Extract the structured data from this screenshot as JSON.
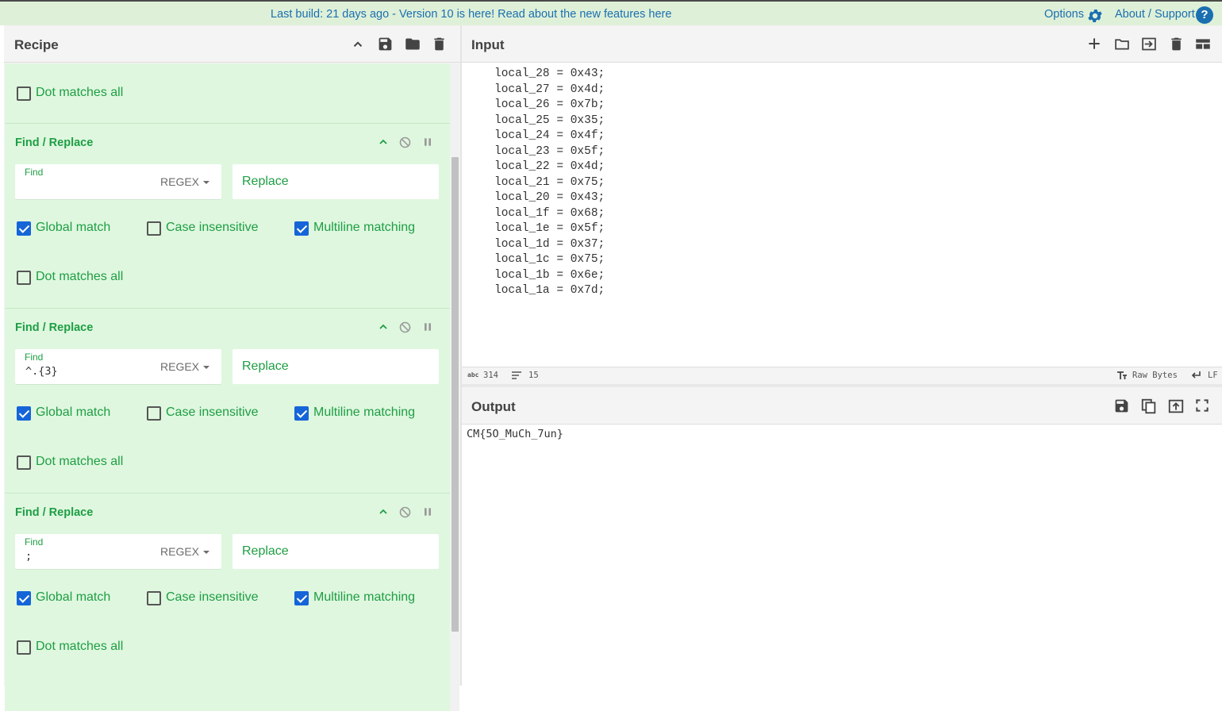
{
  "banner": {
    "message": "Last build: 21 days ago - Version 10 is here! Read about the new features here",
    "options_label": "Options",
    "about_label": "About / Support",
    "help_glyph": "?"
  },
  "recipe": {
    "title": "Recipe",
    "first_op_tail": {
      "dot_label": "Dot matches all"
    },
    "operations": [
      {
        "title": "Find / Replace",
        "find_label": "Find",
        "find_value": "",
        "mode": "REGEX",
        "replace_placeholder": "Replace",
        "global_label": "Global match",
        "case_label": "Case insensitive",
        "multiline_label": "Multiline matching",
        "dot_label": "Dot matches all",
        "global_checked": true,
        "case_checked": false,
        "multiline_checked": true,
        "dot_checked": false
      },
      {
        "title": "Find / Replace",
        "find_label": "Find",
        "find_value": "^.{3}",
        "mode": "REGEX",
        "replace_placeholder": "Replace",
        "global_label": "Global match",
        "case_label": "Case insensitive",
        "multiline_label": "Multiline matching",
        "dot_label": "Dot matches all",
        "global_checked": true,
        "case_checked": false,
        "multiline_checked": true,
        "dot_checked": false
      },
      {
        "title": "Find / Replace",
        "find_label": "Find",
        "find_value": ";",
        "mode": "REGEX",
        "replace_placeholder": "Replace",
        "global_label": "Global match",
        "case_label": "Case insensitive",
        "multiline_label": "Multiline matching",
        "dot_label": "Dot matches all",
        "global_checked": true,
        "case_checked": false,
        "multiline_checked": true,
        "dot_checked": false
      }
    ]
  },
  "input": {
    "title": "Input",
    "text": "local_28 = 0x43;\nlocal_27 = 0x4d;\nlocal_26 = 0x7b;\nlocal_25 = 0x35;\nlocal_24 = 0x4f;\nlocal_23 = 0x5f;\nlocal_22 = 0x4d;\nlocal_21 = 0x75;\nlocal_20 = 0x43;\nlocal_1f = 0x68;\nlocal_1e = 0x5f;\nlocal_1d = 0x37;\nlocal_1c = 0x75;\nlocal_1b = 0x6e;\nlocal_1a = 0x7d;",
    "status": {
      "length_icon": "abc",
      "length": "314",
      "lines": "15",
      "encoding": "Raw Bytes",
      "eol": "LF"
    }
  },
  "output": {
    "title": "Output",
    "text": "CM{5O_MuCh_7un}"
  },
  "colors": {
    "accent_green": "#1e9e44",
    "recipe_bg": "#dff7df",
    "banner_bg": "#dff0d8",
    "link_blue": "#1a6fb0",
    "checkbox_blue": "#1565d8"
  },
  "icons": {
    "recipe_header": [
      "chevron-up-icon",
      "save-icon",
      "folder-open-icon",
      "trash-icon"
    ],
    "op_controls": [
      "chevron-up-icon",
      "disable-icon",
      "pause-icon"
    ],
    "input_header": [
      "plus-icon",
      "folder-open-icon",
      "import-icon",
      "trash-icon",
      "layout-icon"
    ],
    "output_header": [
      "save-icon",
      "copy-icon",
      "replace-input-icon",
      "fullscreen-icon"
    ]
  }
}
